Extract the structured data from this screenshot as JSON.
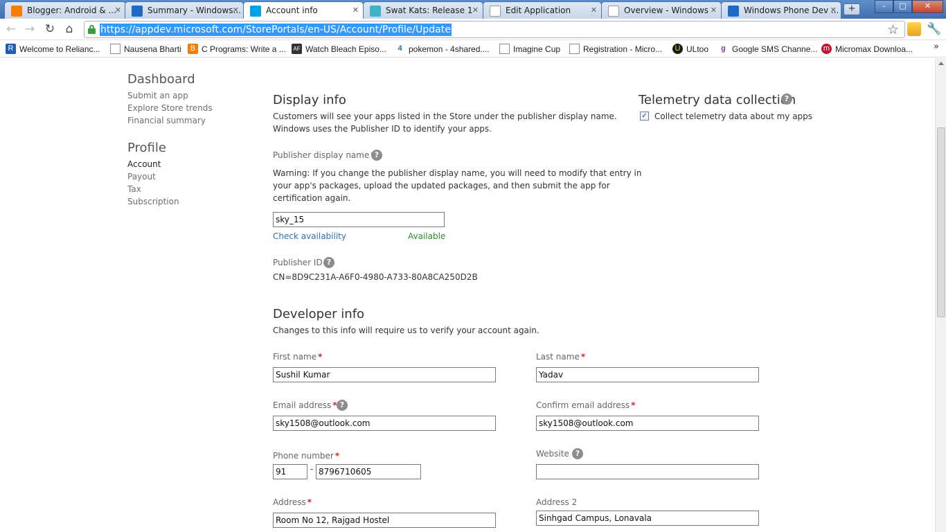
{
  "browser": {
    "tabs": [
      {
        "title": "Blogger: Android & ...",
        "favicon_color": "#f57d00"
      },
      {
        "title": "Summary - Windows...",
        "favicon_color": "#1e6ac7"
      },
      {
        "title": "Account info",
        "favicon_color": "#00a2e8"
      },
      {
        "title": "Swat Kats: Release 1",
        "favicon_color": "#3fb2c8"
      },
      {
        "title": "Edit Application",
        "favicon_color": "#ffffff"
      },
      {
        "title": "Overview - Windows",
        "favicon_color": "#ffffff"
      },
      {
        "title": "Windows Phone Dev ...",
        "favicon_color": "#1e6ac7"
      }
    ],
    "new_tab_label": "+",
    "window_buttons": {
      "minimize": "–",
      "maximize": "□",
      "close": "✕"
    },
    "url": "https://appdev.microsoft.com/StorePortals/en-US/Account/Profile/Update",
    "bookmarks": [
      {
        "label": "Welcome to Relianc...",
        "icon": "R",
        "icon_color": "#1e5fb3"
      },
      {
        "label": "Nausena Bharti",
        "icon": "",
        "icon_color": "page"
      },
      {
        "label": "C Programs: Write a ...",
        "icon": "B",
        "icon_color": "#f57d00"
      },
      {
        "label": "Watch Bleach Episo...",
        "icon": "AF",
        "icon_color": "#333333"
      },
      {
        "label": "pokemon - 4shared....",
        "icon": "4",
        "icon_color": "#1d6fb8"
      },
      {
        "label": "Imagine Cup",
        "icon": "",
        "icon_color": "page"
      },
      {
        "label": "Registration - Micro...",
        "icon": "",
        "icon_color": "page"
      },
      {
        "label": "ULtoo",
        "icon": "U",
        "icon_color": "#1a1a1a"
      },
      {
        "label": "Google SMS Channe...",
        "icon": "g",
        "icon_color": "#7b3fb0"
      },
      {
        "label": "Micromax Downloa...",
        "icon": "m",
        "icon_color": "#c8102e"
      }
    ],
    "bookmarks_more": "»"
  },
  "sidebar": {
    "dashboard_heading": "Dashboard",
    "dashboard_links": [
      "Submit an app",
      "Explore Store trends",
      "Financial summary"
    ],
    "profile_heading": "Profile",
    "profile_links": [
      "Account",
      "Payout",
      "Tax",
      "Subscription"
    ]
  },
  "display_info": {
    "heading": "Display info",
    "description_line1": "Customers will see your apps listed in the Store under the publisher display name.",
    "description_line2": "Windows uses the Publisher ID to identify your apps.",
    "publisher_label": "Publisher display name",
    "warning_line1": "Warning: If you change the publisher display name, you will need to modify that entry in",
    "warning_line2": "your app's packages, upload the updated packages, and then submit the app for",
    "warning_line3": "certification again.",
    "publisher_value": "sky_15",
    "check_link": "Check availability",
    "status": "Available",
    "publisher_id_label": "Publisher ID",
    "publisher_id_value": "CN=8D9C231A-A6F0-4980-A733-80A8CA250D2B"
  },
  "telemetry": {
    "heading": "Telemetry data collection",
    "checkbox_label": "Collect telemetry data about my apps",
    "checked": true,
    "check_glyph": "✓"
  },
  "developer_info": {
    "heading": "Developer info",
    "description": "Changes to this info will require us to verify your account again.",
    "first_name_label": "First name",
    "first_name": "Sushil Kumar",
    "last_name_label": "Last name",
    "last_name": "Yadav",
    "email_label": "Email address",
    "email": "sky1508@outlook.com",
    "confirm_email_label": "Confirm email address",
    "confirm_email": "sky1508@outlook.com",
    "phone_label": "Phone number",
    "phone_country": "91",
    "phone_separator": "-",
    "phone_number": "8796710605",
    "website_label": "Website",
    "website": "",
    "address_label": "Address",
    "address": "Room No 12, Rajgad Hostel",
    "address2_label": "Address 2",
    "address2": "Sinhgad Campus, Lonavala"
  },
  "common": {
    "required_mark": "*",
    "help_glyph": "?"
  }
}
